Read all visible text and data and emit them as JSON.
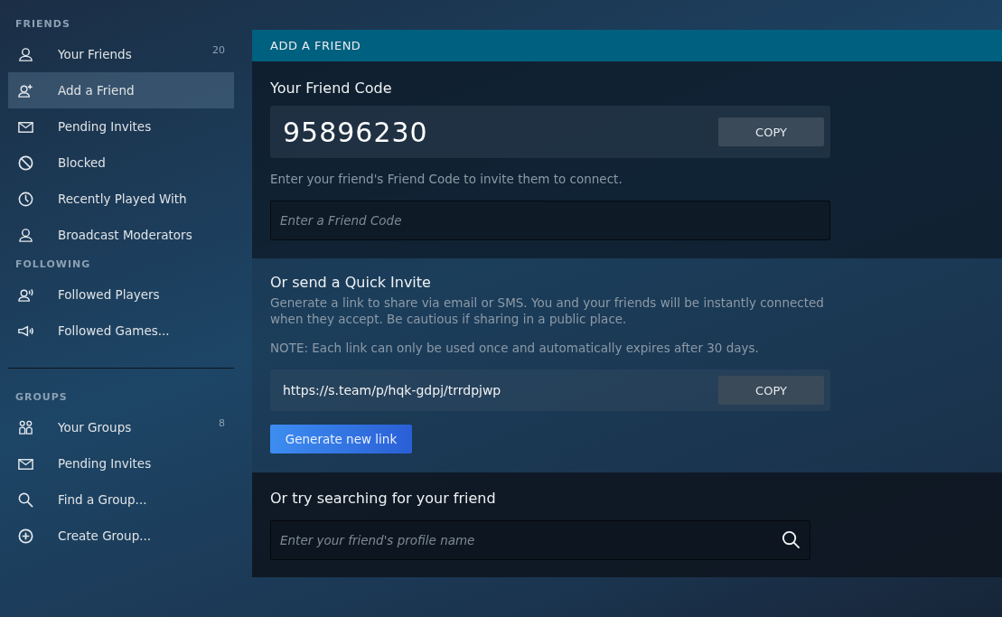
{
  "sidebar": {
    "sections": [
      {
        "title": "FRIENDS",
        "items": [
          {
            "label": "Your Friends",
            "count": "20",
            "selected": false
          },
          {
            "label": "Add a Friend",
            "selected": true
          },
          {
            "label": "Pending Invites",
            "selected": false
          },
          {
            "label": "Blocked",
            "selected": false
          },
          {
            "label": "Recently Played With",
            "selected": false
          },
          {
            "label": "Broadcast Moderators",
            "selected": false
          }
        ]
      },
      {
        "title": "FOLLOWING",
        "items": [
          {
            "label": "Followed Players",
            "selected": false
          },
          {
            "label": "Followed Games...",
            "selected": false
          }
        ]
      },
      {
        "title": "GROUPS",
        "items": [
          {
            "label": "Your Groups",
            "count": "8",
            "selected": false
          },
          {
            "label": "Pending Invites",
            "selected": false
          },
          {
            "label": "Find a Group...",
            "selected": false
          },
          {
            "label": "Create Group...",
            "selected": false
          }
        ]
      }
    ]
  },
  "main": {
    "header": "ADD A FRIEND",
    "friend_code": {
      "title": "Your Friend Code",
      "code": "95896230",
      "copy_button": "COPY",
      "hint": "Enter your friend's Friend Code to invite them to connect.",
      "input": {
        "placeholder": "Enter a Friend Code"
      }
    },
    "quick_invite": {
      "title": "Or send a Quick Invite",
      "description": "Generate a link to share via email or SMS. You and your friends will be instantly connected when they accept. Be cautious if sharing in a public place.",
      "note": "NOTE: Each link can only be used once and automatically expires after 30 days.",
      "link": "https://s.team/p/hqk-gdpj/trrdpjwp",
      "copy_button": "COPY",
      "generate_button": "Generate new link"
    },
    "search": {
      "title": "Or try searching for your friend",
      "input": {
        "placeholder": "Enter your friend's profile name"
      }
    }
  }
}
